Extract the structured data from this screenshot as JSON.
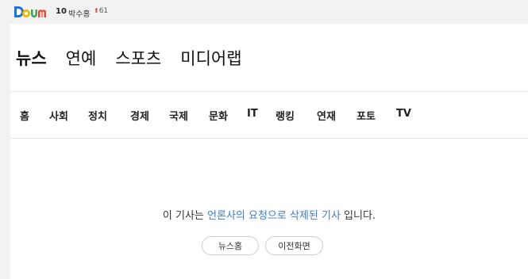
{
  "header": {
    "logo_text": "Daum",
    "rank": "10",
    "keyword": "박수홍",
    "change": "61"
  },
  "gnb": [
    "뉴스",
    "연예",
    "스포츠",
    "미디어랩"
  ],
  "lnb": [
    "홈",
    "사회",
    "정치",
    "경제",
    "국제",
    "문화",
    "IT",
    "랭킹",
    "연재",
    "포토",
    "TV"
  ],
  "message": {
    "prefix": "이 기사는 ",
    "highlight": "언론사의 요청으로 삭제된 기사",
    "suffix": " 입니다."
  },
  "buttons": {
    "news_home": "뉴스홈",
    "prev_page": "이전화면"
  },
  "colors": {
    "link_blue": "#3b7ec5",
    "up_red": "#e8412c"
  }
}
